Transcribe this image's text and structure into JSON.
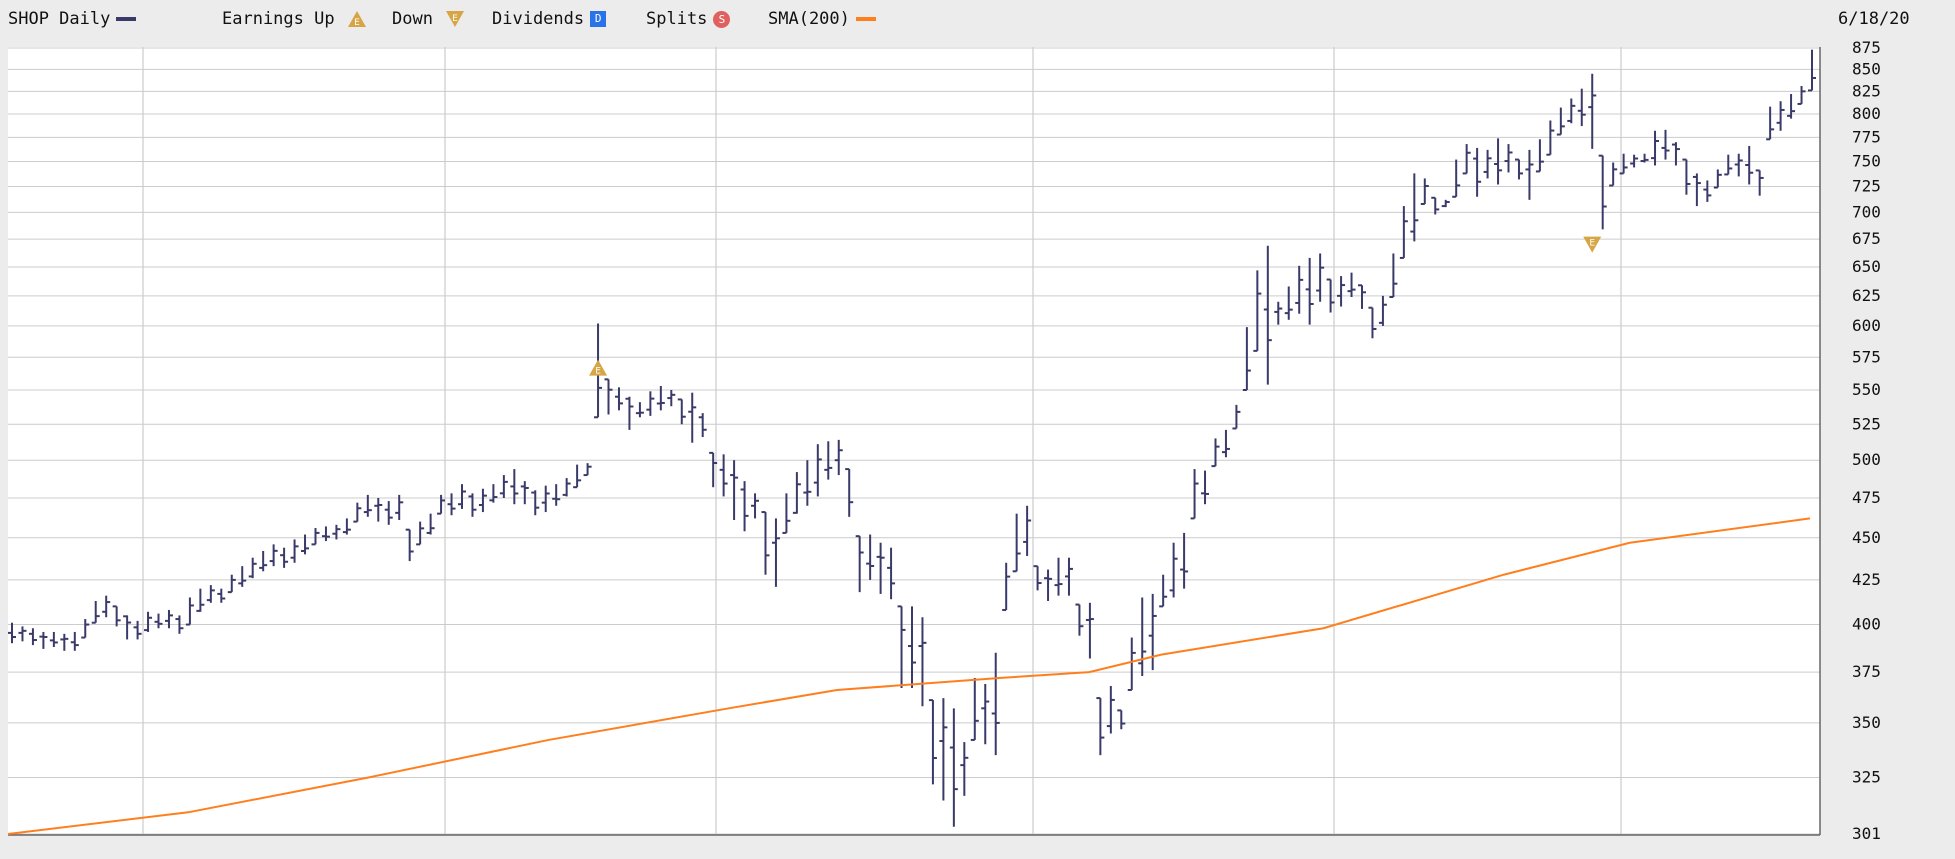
{
  "legend": {
    "symbol_label": "SHOP Daily",
    "earnings_up_label": "Earnings Up",
    "earnings_up_glyph": "E",
    "down_label": "Down",
    "down_glyph": "E",
    "dividends_label": "Dividends",
    "dividends_glyph": "D",
    "splits_label": "Splits",
    "splits_glyph": "S",
    "sma_label": "SMA(200)",
    "date": "6/18/20"
  },
  "colors": {
    "price": "#3a3a6a",
    "sma": "#ff7f1f",
    "earnings": "#d6a544",
    "dividends": "#2a72e8",
    "splits": "#e06060",
    "grid": "#cccccc"
  },
  "chart_data": {
    "type": "ohlc",
    "y_scale": "log",
    "ylim": [
      301,
      875
    ],
    "y_ticks": [
      875,
      850,
      825,
      800,
      775,
      750,
      725,
      700,
      675,
      650,
      625,
      600,
      575,
      550,
      525,
      500,
      475,
      450,
      425,
      400,
      375,
      350,
      325,
      301
    ],
    "series": [
      {
        "name": "SHOP Daily",
        "bars": [
          [
            401,
            390
          ],
          [
            399,
            391
          ],
          [
            398,
            389
          ],
          [
            396,
            387
          ],
          [
            396,
            388
          ],
          [
            395,
            386
          ],
          [
            396,
            386
          ],
          [
            403,
            393
          ],
          [
            413,
            401
          ],
          [
            416,
            404
          ],
          [
            410,
            399
          ],
          [
            405,
            392
          ],
          [
            402,
            392
          ],
          [
            407,
            396
          ],
          [
            406,
            398
          ],
          [
            408,
            398
          ],
          [
            405,
            395
          ],
          [
            415,
            400
          ],
          [
            420,
            407
          ],
          [
            422,
            412
          ],
          [
            420,
            412
          ],
          [
            428,
            418
          ],
          [
            433,
            421
          ],
          [
            438,
            426
          ],
          [
            442,
            430
          ],
          [
            446,
            433
          ],
          [
            444,
            432
          ],
          [
            449,
            435
          ],
          [
            452,
            440
          ],
          [
            456,
            446
          ],
          [
            457,
            448
          ],
          [
            458,
            449
          ],
          [
            462,
            452
          ],
          [
            472,
            460
          ],
          [
            477,
            463
          ],
          [
            475,
            460
          ],
          [
            473,
            458
          ],
          [
            477,
            461
          ],
          [
            455,
            436
          ],
          [
            460,
            446
          ],
          [
            465,
            452
          ],
          [
            477,
            465
          ],
          [
            478,
            464
          ],
          [
            484,
            468
          ],
          [
            478,
            463
          ],
          [
            481,
            466
          ],
          [
            484,
            472
          ],
          [
            490,
            475
          ],
          [
            494,
            471
          ],
          [
            486,
            471
          ],
          [
            480,
            464
          ],
          [
            483,
            466
          ],
          [
            484,
            470
          ],
          [
            488,
            476
          ],
          [
            497,
            482
          ],
          [
            498,
            490
          ],
          [
            602,
            530
          ],
          [
            558,
            532
          ],
          [
            552,
            535
          ],
          [
            545,
            521
          ],
          [
            541,
            530
          ],
          [
            549,
            531
          ],
          [
            553,
            535
          ],
          [
            550,
            538
          ],
          [
            543,
            525
          ],
          [
            548,
            512
          ],
          [
            533,
            516
          ],
          [
            505,
            482
          ],
          [
            504,
            476
          ],
          [
            500,
            461
          ],
          [
            486,
            454
          ],
          [
            478,
            462
          ],
          [
            466,
            428
          ],
          [
            462,
            421
          ],
          [
            478,
            453
          ],
          [
            492,
            465
          ],
          [
            500,
            470
          ],
          [
            511,
            476
          ],
          [
            513,
            487
          ],
          [
            514,
            490
          ],
          [
            494,
            463
          ],
          [
            451,
            418
          ],
          [
            452,
            425
          ],
          [
            447,
            417
          ],
          [
            444,
            414
          ],
          [
            410,
            367
          ],
          [
            410,
            367
          ],
          [
            404,
            358
          ],
          [
            361,
            322
          ],
          [
            362,
            315
          ],
          [
            357,
            304
          ],
          [
            341,
            317
          ],
          [
            372,
            342
          ],
          [
            369,
            340
          ],
          [
            385,
            335
          ],
          [
            435,
            408
          ],
          [
            465,
            430
          ],
          [
            470,
            439
          ],
          [
            433,
            419
          ],
          [
            431,
            413
          ],
          [
            438,
            416
          ],
          [
            438,
            416
          ],
          [
            411,
            394
          ],
          [
            412,
            382
          ],
          [
            362,
            335
          ],
          [
            368,
            345
          ],
          [
            356,
            347
          ],
          [
            393,
            366
          ],
          [
            415,
            373
          ],
          [
            417,
            376
          ],
          [
            428,
            410
          ],
          [
            447,
            415
          ],
          [
            453,
            420
          ],
          [
            494,
            462
          ],
          [
            493,
            471
          ],
          [
            515,
            496
          ],
          [
            521,
            502
          ],
          [
            539,
            522
          ],
          [
            599,
            550
          ],
          [
            647,
            580
          ],
          [
            669,
            554
          ],
          [
            620,
            601
          ],
          [
            633,
            605
          ],
          [
            651,
            610
          ],
          [
            658,
            601
          ],
          [
            662,
            620
          ],
          [
            639,
            611
          ],
          [
            642,
            616
          ],
          [
            645,
            624
          ],
          [
            634,
            614
          ],
          [
            615,
            590
          ],
          [
            625,
            600
          ],
          [
            662,
            624
          ],
          [
            706,
            658
          ],
          [
            738,
            673
          ],
          [
            733,
            708
          ],
          [
            714,
            698
          ],
          [
            712,
            705
          ],
          [
            752,
            715
          ],
          [
            768,
            738
          ],
          [
            764,
            715
          ],
          [
            762,
            733
          ],
          [
            774,
            727
          ],
          [
            768,
            739
          ],
          [
            752,
            732
          ],
          [
            762,
            712
          ],
          [
            773,
            740
          ],
          [
            793,
            757
          ],
          [
            807,
            778
          ],
          [
            817,
            790
          ],
          [
            828,
            787
          ],
          [
            845,
            763
          ],
          [
            756,
            684
          ],
          [
            749,
            726
          ],
          [
            758,
            738
          ],
          [
            757,
            744
          ],
          [
            758,
            749
          ],
          [
            782,
            746
          ],
          [
            783,
            752
          ],
          [
            770,
            746
          ],
          [
            752,
            717
          ],
          [
            738,
            706
          ],
          [
            731,
            710
          ],
          [
            742,
            724
          ],
          [
            757,
            737
          ],
          [
            758,
            735
          ],
          [
            766,
            727
          ],
          [
            741,
            716
          ],
          [
            808,
            773
          ],
          [
            814,
            782
          ],
          [
            822,
            795
          ],
          [
            831,
            811
          ],
          [
            873,
            826
          ]
        ]
      },
      {
        "name": "SMA(200)",
        "points": [
          [
            0,
            301
          ],
          [
            0.1,
            310
          ],
          [
            0.2,
            325
          ],
          [
            0.3,
            342
          ],
          [
            0.4,
            357
          ],
          [
            0.46,
            366
          ],
          [
            0.55,
            372
          ],
          [
            0.6,
            375
          ],
          [
            0.64,
            384
          ],
          [
            0.73,
            398
          ],
          [
            0.83,
            428
          ],
          [
            0.9,
            447
          ],
          [
            1.0,
            462
          ]
        ]
      }
    ],
    "earnings_markers": [
      {
        "type": "up",
        "bar_index": 56,
        "value": 567
      },
      {
        "type": "down",
        "bar_index": 151,
        "value": 670
      }
    ]
  }
}
